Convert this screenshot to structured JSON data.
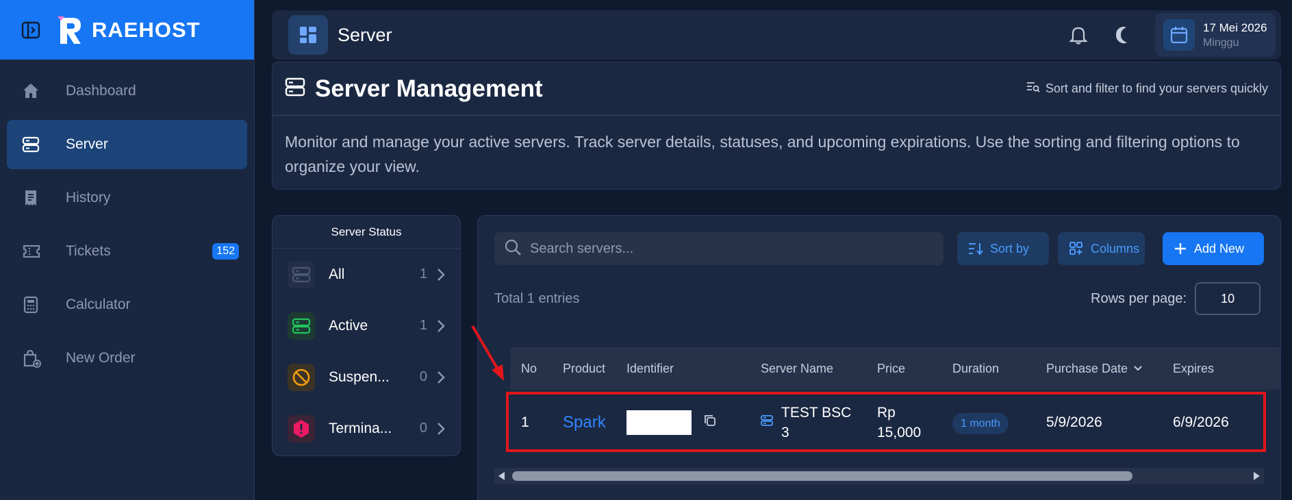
{
  "brand": {
    "name": "RAEHOST"
  },
  "sidebar": {
    "items": [
      {
        "label": "Dashboard",
        "icon": "home-icon"
      },
      {
        "label": "Server",
        "icon": "server-icon",
        "active": true
      },
      {
        "label": "History",
        "icon": "receipt-icon"
      },
      {
        "label": "Tickets",
        "icon": "ticket-icon",
        "badge": "152"
      },
      {
        "label": "Calculator",
        "icon": "calculator-icon"
      },
      {
        "label": "New Order",
        "icon": "shopping-bag-icon"
      }
    ]
  },
  "header": {
    "title": "Server",
    "date": "17 Mei 2026",
    "day": "Minggu"
  },
  "management": {
    "title": "Server Management",
    "hint": "Sort and filter to find your servers quickly",
    "description": "Monitor and manage your active servers. Track server details, statuses, and upcoming expirations. Use the sorting and filtering options to organize your view."
  },
  "status_panel": {
    "title": "Server Status",
    "items": [
      {
        "label": "All",
        "count": "1"
      },
      {
        "label": "Active",
        "count": "1"
      },
      {
        "label": "Suspen...",
        "count": "0"
      },
      {
        "label": "Termina...",
        "count": "0"
      }
    ]
  },
  "toolbar": {
    "search_placeholder": "Search servers...",
    "sort_label": "Sort by",
    "columns_label": "Columns",
    "add_label": "Add New",
    "total": "Total 1 entries",
    "rows_label": "Rows per page:",
    "rows_value": "10"
  },
  "table": {
    "headers": [
      "No",
      "Product",
      "Identifier",
      "Server Name",
      "Price",
      "Duration",
      "Purchase Date",
      "Expires"
    ],
    "rows": [
      {
        "no": "1",
        "product": "Spark",
        "identifier": "",
        "server_name": "TEST BSC 3",
        "price": "Rp 15,000",
        "duration": "1 month",
        "purchase_date": "5/9/2026",
        "expires": "6/9/2026"
      }
    ]
  },
  "colors": {
    "accent": "#1676f3",
    "sidebar_bg": "#1a2740",
    "highlight": "#e0161b",
    "active_green": "#22c55e",
    "suspend_orange": "#f59e0b",
    "terminate_pink": "#ec1a64"
  }
}
